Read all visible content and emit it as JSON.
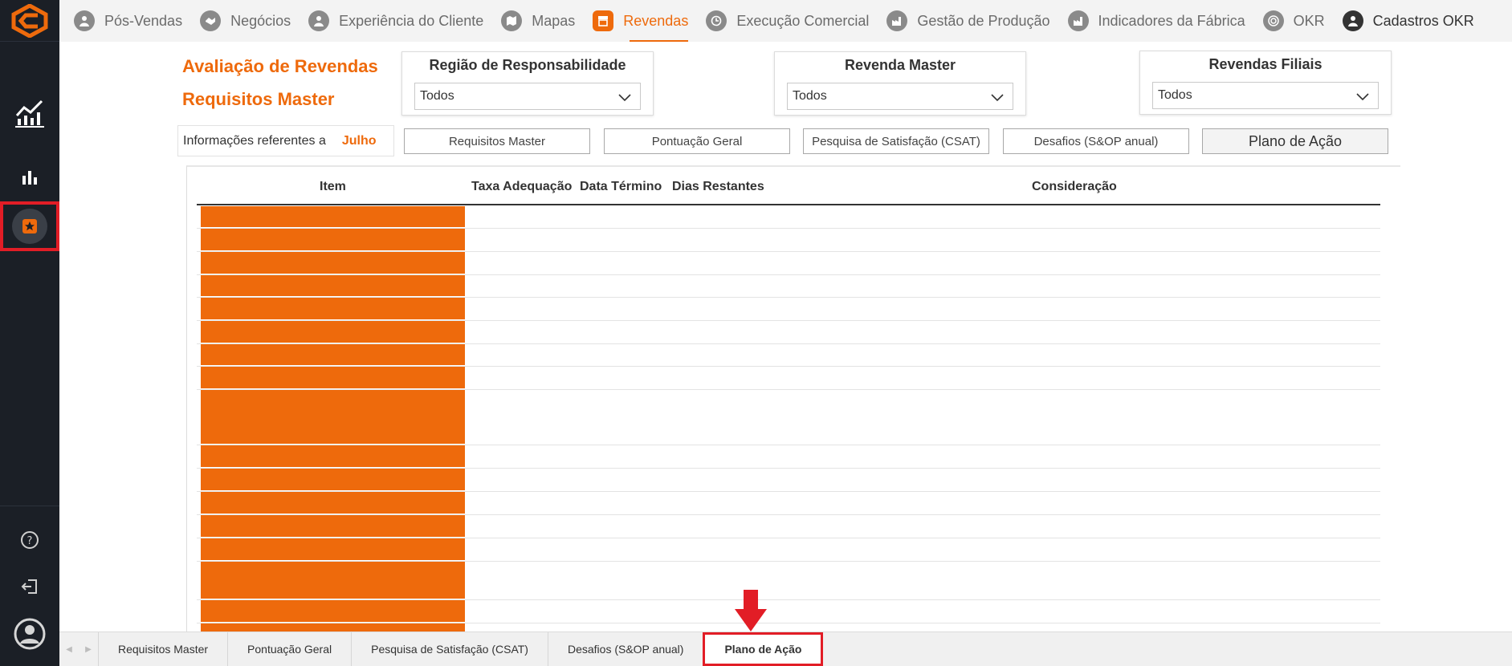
{
  "sidebar": {
    "items": [
      {
        "icon": "app-logo-icon"
      },
      {
        "icon": "line-chart-icon"
      },
      {
        "icon": "bar-chart-icon"
      },
      {
        "icon": "star-icon",
        "active": true
      },
      {
        "icon": "help-icon"
      },
      {
        "icon": "logout-icon"
      },
      {
        "icon": "user-avatar-icon"
      }
    ]
  },
  "topnav": {
    "items": [
      {
        "label": "Pós-Vendas",
        "icon": "person-icon"
      },
      {
        "label": "Negócios",
        "icon": "handshake-icon"
      },
      {
        "label": "Experiência do Cliente",
        "icon": "person-icon"
      },
      {
        "label": "Mapas",
        "icon": "map-icon"
      },
      {
        "label": "Revendas",
        "icon": "store-icon",
        "active": true
      },
      {
        "label": "Execução Comercial",
        "icon": "clock-icon"
      },
      {
        "label": "Gestão de Produção",
        "icon": "factory-icon"
      },
      {
        "label": "Indicadores da Fábrica",
        "icon": "factory-icon"
      },
      {
        "label": "OKR",
        "icon": "target-icon"
      },
      {
        "label": "Cadastros OKR",
        "icon": "user-icon"
      }
    ],
    "colors": {
      "active": "#ee6a0c",
      "inactive": "#6b6b6b"
    }
  },
  "title": {
    "line1": "Avaliação de Revendas",
    "line2": "Requisitos Master"
  },
  "filters": [
    {
      "label": "Região de Responsabilidade",
      "value": "Todos"
    },
    {
      "label": "Revenda Master",
      "value": "Todos"
    },
    {
      "label": "Revendas Filiais",
      "value": "Todos"
    }
  ],
  "info": {
    "label": "Informações referentes a",
    "month": "Julho"
  },
  "tabs": [
    {
      "label": "Requisitos Master"
    },
    {
      "label": "Pontuação Geral"
    },
    {
      "label": "Pesquisa de Satisfação (CSAT)"
    },
    {
      "label": "Desafios (S&OP anual)"
    },
    {
      "label": "Plano de Ação",
      "current": true
    }
  ],
  "table": {
    "columns": [
      "Item",
      "Taxa Adequação",
      "Data Término",
      "Dias Restantes",
      "Consideração"
    ],
    "row_fill": "#ee6a0c"
  },
  "page_tabs": [
    {
      "label": "Requisitos Master"
    },
    {
      "label": "Pontuação Geral"
    },
    {
      "label": "Pesquisa de Satisfação (CSAT)"
    },
    {
      "label": "Desafios (S&OP anual)"
    },
    {
      "label": "Plano de Ação",
      "current": true
    }
  ],
  "highlight_color": "#e21d26"
}
